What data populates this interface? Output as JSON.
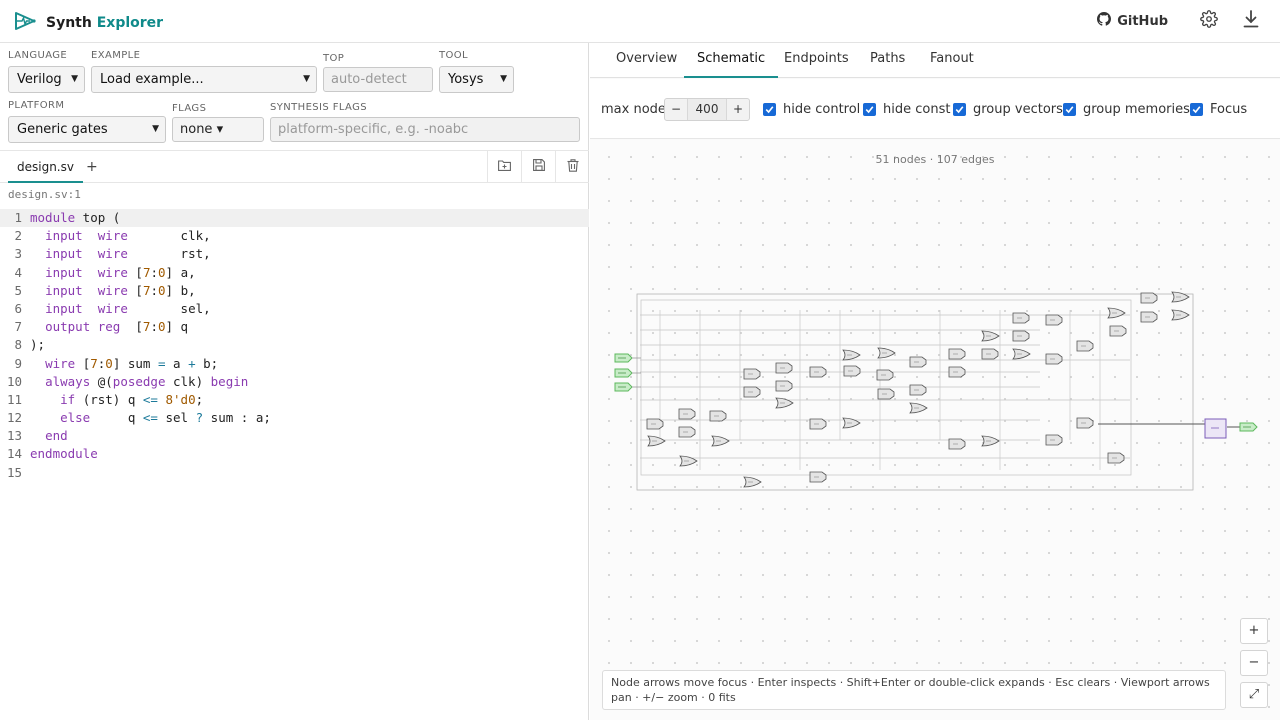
{
  "header": {
    "brand_main": "Synth",
    "brand_accent": "Explorer",
    "github_label": "GitHub",
    "icons": [
      "logo-icon",
      "github-icon",
      "gear-icon",
      "download-icon"
    ]
  },
  "controls": {
    "language": {
      "label": "LANGUAGE",
      "value": "Verilog"
    },
    "example": {
      "label": "EXAMPLE",
      "value": "Load example..."
    },
    "top": {
      "label": "TOP",
      "placeholder": "auto-detect"
    },
    "tool": {
      "label": "TOOL",
      "value": "Yosys"
    },
    "platform": {
      "label": "PLATFORM",
      "value": "Generic gates"
    },
    "flags": {
      "label": "FLAGS",
      "value": "none ▾"
    },
    "synth_flags": {
      "label": "SYNTHESIS FLAGS",
      "placeholder": "platform-specific, e.g. -noabc"
    }
  },
  "editor": {
    "file_tab": "design.sv",
    "add_tab": "+",
    "breadcrumb": "design.sv:1",
    "line_count": 15
  },
  "right_tabs": [
    "Overview",
    "Schematic",
    "Endpoints",
    "Paths",
    "Fanout"
  ],
  "active_tab": "Schematic",
  "toolbar": {
    "max_nodes_label": "max nodes",
    "minus": "−",
    "plus": "+",
    "max_nodes_value": "400",
    "hide_control": "hide control",
    "hide_const": "hide const",
    "group_vectors": "group vectors",
    "group_memories": "group memories",
    "focus": "Focus",
    "checked_color": "#1769d6"
  },
  "schematic": {
    "stats": "51 nodes · 107 edges",
    "hint": "Node arrows move focus · Enter inspects · Shift+Enter or double-click expands · Esc clears · Viewport arrows pan · +/− zoom · 0 fits",
    "zoom_in": "+",
    "zoom_out": "−",
    "fit": "⤢",
    "input_color": "#5cb85c",
    "output_color": "#7b5cb8"
  }
}
